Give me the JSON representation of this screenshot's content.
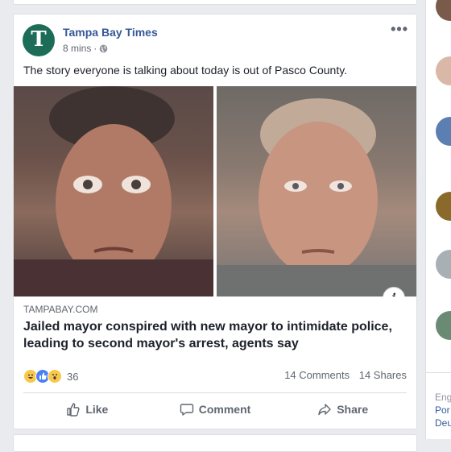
{
  "post": {
    "page_name": "Tampa Bay Times",
    "logo_letter": "T",
    "time": "8 mins",
    "separator": "·",
    "text": "The story everyone is talking about today is out of Pasco County.",
    "more_glyph": "•••",
    "info_glyph": "i",
    "link": {
      "domain": "TAMPABAY.COM",
      "headline": "Jailed mayor conspired with new mayor to intimidate police, leading to second mayor's arrest, agents say"
    },
    "reactions": {
      "icons": [
        "haha-icon",
        "like-icon",
        "wow-icon"
      ],
      "count": "36"
    },
    "comments": "14 Comments",
    "shares": "14 Shares",
    "actions": {
      "like": "Like",
      "comment": "Comment",
      "share": "Share"
    }
  },
  "right_column": {
    "texts": [
      "Eng",
      "Por",
      "Deu"
    ]
  },
  "colors": {
    "link_blue": "#365899",
    "logo_green": "#1d6c58",
    "background": "#e9ebee"
  }
}
